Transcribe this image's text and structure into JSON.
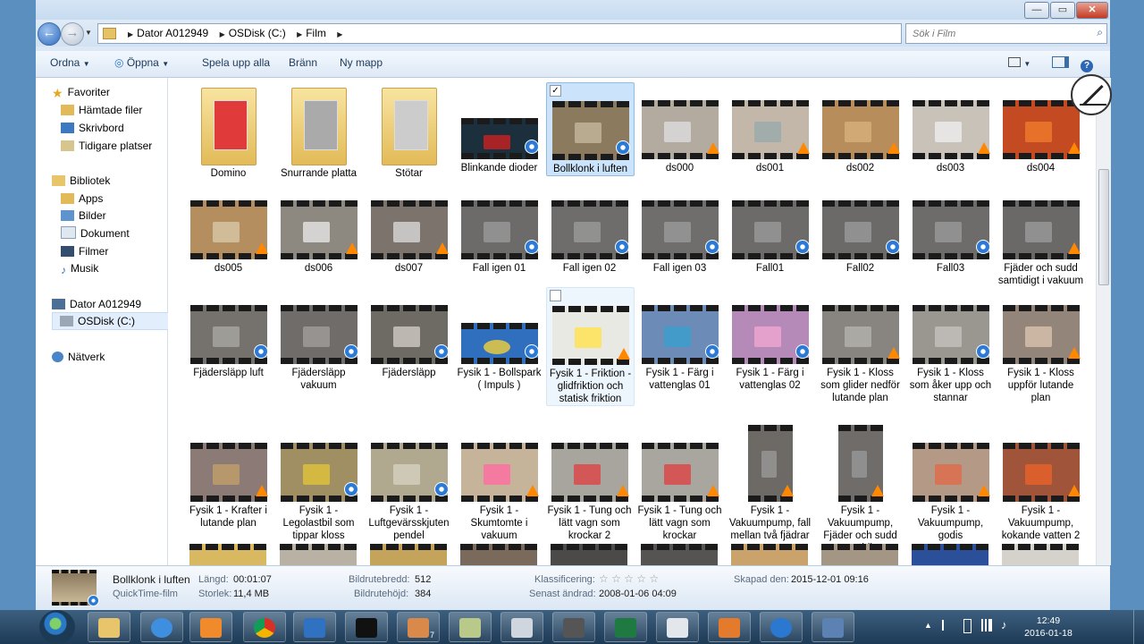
{
  "window": {
    "controls": {
      "minimize": "—",
      "maximize": "▭",
      "close": "✕"
    }
  },
  "address": {
    "crumbs": [
      "Dator A012949",
      "OSDisk (C:)",
      "Film"
    ],
    "search_placeholder": "Sök i Film"
  },
  "toolbar": {
    "organize": "Ordna",
    "open": "Öppna",
    "play_all": "Spela upp alla",
    "burn": "Bränn",
    "new_folder": "Ny mapp"
  },
  "nav": {
    "favorites": "Favoriter",
    "downloads": "Hämtade filer",
    "desktop": "Skrivbord",
    "recent": "Tidigare platser",
    "libraries": "Bibliotek",
    "apps": "Apps",
    "pictures": "Bilder",
    "documents": "Dokument",
    "videos": "Filmer",
    "music": "Musik",
    "computer": "Dator A012949",
    "osdisk": "OSDisk (C:)",
    "network": "Nätverk"
  },
  "files": [
    [
      "Domino",
      "Snurrande platta",
      "Stötar",
      "Blinkande dioder",
      "Bollklonk i luften",
      "ds000",
      "ds001",
      "ds002",
      "ds003",
      "ds004"
    ],
    [
      "ds005",
      "ds006",
      "ds007",
      "Fall igen 01",
      "Fall igen 02",
      "Fall igen 03",
      "Fall01",
      "Fall02",
      "Fall03",
      "Fjäder och sudd samtidigt i vakuum"
    ],
    [
      "Fjädersläpp luft",
      "Fjädersläpp vakuum",
      "Fjädersläpp",
      "Fysik 1 - Bollspark ( Impuls )",
      "Fysik 1 - Friktion - glidfriktion och statisk friktion",
      "Fysik 1 - Färg i vattenglas 01",
      "Fysik 1 - Färg i vattenglas 02",
      "Fysik 1 - Kloss som glider nedför lutande plan",
      "Fysik 1 - Kloss som åker upp och stannar",
      "Fysik 1 - Kloss uppför lutande plan"
    ],
    [
      "Fysik 1 - Krafter i lutande plan",
      "Fysik 1 - Legolastbil som tippar kloss",
      "Fysik 1 - Luftgevärsskjuten pendel",
      "Fysik 1 - Skumtomte i vakuum",
      "Fysik 1 - Tung och lätt vagn som krockar 2",
      "Fysik 1 - Tung och lätt vagn som krockar",
      "Fysik 1 - Vakuumpump, fall mellan två fjädrar",
      "Fysik 1 - Vakuumpump, Fjäder och sudd samtidigt",
      "Fysik 1 - Vakuumpump, godis",
      "Fysik 1 - Vakuumpump, kokande vatten 2"
    ]
  ],
  "details": {
    "name": "Bollklonk i luften",
    "type": "QuickTime-film",
    "length_label": "Längd:",
    "length": "00:01:07",
    "size_label": "Storlek:",
    "size": "11,4 MB",
    "width_label": "Bildrutebredd:",
    "width": "512",
    "height_label": "Bildrutehöjd:",
    "height": "384",
    "rating_label": "Klassificering:",
    "rating": "☆ ☆ ☆ ☆ ☆",
    "modified_label": "Senast ändrad:",
    "modified": "2008-01-06 04:09",
    "created_label": "Skapad den:",
    "created": "2015-12-01 09:16"
  },
  "taskbar": {
    "time": "12:49",
    "date": "2016-01-18",
    "badge": "7"
  }
}
